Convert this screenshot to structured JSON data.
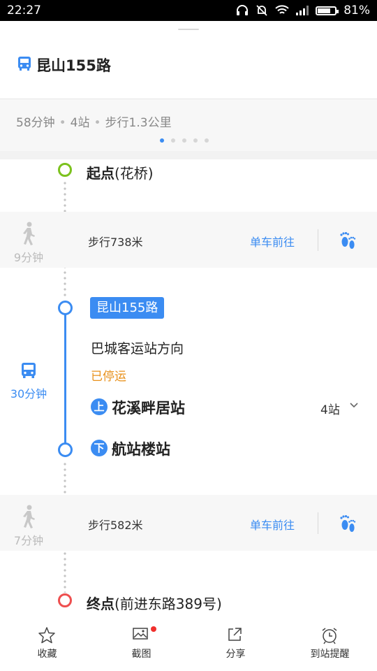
{
  "status_bar": {
    "time": "22:27",
    "battery": "81%",
    "battery_level": 0.81
  },
  "header": {
    "route_title": "昆山155路"
  },
  "summary": {
    "duration": "58分钟",
    "stops": "4站",
    "walk": "步行1.3公里",
    "page_count": 5,
    "active_page": 1
  },
  "start": {
    "prefix": "起点",
    "name": "(花桥)"
  },
  "walk1": {
    "time": "9分钟",
    "distance": "步行738米",
    "bike_label": "单车前往"
  },
  "bus": {
    "line_tag": "昆山155路",
    "direction": "巴城客运站方向",
    "status": "已停运",
    "side_time": "30分钟",
    "board_badge": "上",
    "board_stop": "花溪畔居站",
    "stop_count": "4站",
    "alight_badge": "下",
    "alight_stop": "航站楼站"
  },
  "walk2": {
    "time": "7分钟",
    "distance": "步行582米",
    "bike_label": "单车前往"
  },
  "end": {
    "prefix": "终点",
    "name": "(前进东路389号)"
  },
  "bottom_bar": {
    "favorite": "收藏",
    "screenshot": "截图",
    "share": "分享",
    "remind": "到站提醒"
  },
  "colors": {
    "accent": "#3b8cf2",
    "start_node": "#7cc21e",
    "end_node": "#ee4f4f",
    "stopped": "#e8901a",
    "badge_dot": "#f0302d"
  }
}
